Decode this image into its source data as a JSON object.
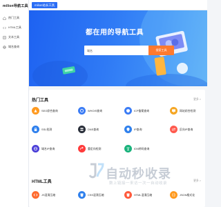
{
  "sidebar": {
    "logo": "milion导航工具",
    "items": [
      {
        "label": "热门工具",
        "icon": "home-icon"
      },
      {
        "label": "HTML工具",
        "icon": "code-icon"
      },
      {
        "label": "文本工具",
        "icon": "text-icon"
      },
      {
        "label": "域名查询",
        "icon": "globe-icon"
      }
    ]
  },
  "topbar": {
    "active_tab": "milion站长工具"
  },
  "hero": {
    "title": "都在用的导航工具",
    "search_placeholder": "域名",
    "search_button": "搜索工具"
  },
  "hot_tools": {
    "title": "热门工具",
    "more": "更多 >",
    "items": [
      {
        "label": "SEO综合查询",
        "icon": "seo-icon",
        "color": "#ff9a1f"
      },
      {
        "label": "WHOIS查询",
        "icon": "whois-icon",
        "color": "#3b7cf5"
      },
      {
        "label": "ICP备案查询",
        "icon": "icp-icon",
        "color": "#3b7cf5"
      },
      {
        "label": "网站综合检测",
        "icon": "monitor-icon",
        "color": "#f5a623"
      },
      {
        "label": "SSL检测",
        "icon": "lock-icon",
        "color": "#2f80ed"
      },
      {
        "label": "DNS查询",
        "icon": "dns-icon",
        "color": "#2a2f3a"
      },
      {
        "label": "IP查询",
        "icon": "ip-icon",
        "color": "#2f80ed"
      },
      {
        "label": "反向IP查询",
        "icon": "reverse-ip-icon",
        "color": "#ff5a4e"
      },
      {
        "label": "域名IP查询",
        "icon": "domain-ip-icon",
        "color": "#4b3fd8"
      },
      {
        "label": "重定向检测",
        "icon": "redirect-icon",
        "color": "#ff3b3b"
      },
      {
        "label": "IDN转码查询",
        "icon": "idn-icon",
        "color": "#1ab37c"
      }
    ]
  },
  "html_tools": {
    "title": "HTML工具",
    "more": "更多 >",
    "items": [
      {
        "label": "JS混淆压缩",
        "icon": "js-icon",
        "color": "#ff6a2e"
      },
      {
        "label": "CSS混淆压缩",
        "icon": "css-icon",
        "color": "#2f80ed"
      },
      {
        "label": "HTML混淆压缩",
        "icon": "html-icon",
        "color": "#ff5a3c"
      },
      {
        "label": "JSON格式化",
        "icon": "json-icon",
        "color": "#ff9a1f"
      }
    ]
  },
  "watermark": {
    "main": "自动秒收录",
    "sub": "数上链接一来访一次一自动收录"
  }
}
